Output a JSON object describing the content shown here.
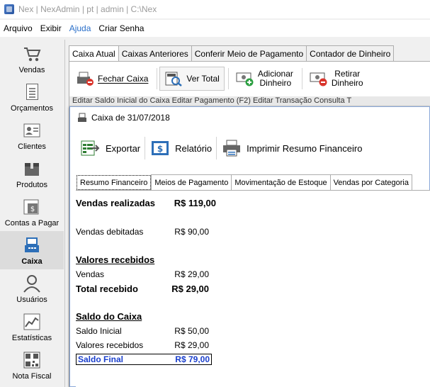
{
  "window": {
    "title": "Nex | NexAdmin | pt | admin | C:\\Nex"
  },
  "menu": [
    "Arquivo",
    "Exibir",
    "Ajuda",
    "Criar Senha"
  ],
  "sidebar": [
    {
      "label": "Vendas",
      "icon": "cart-icon"
    },
    {
      "label": "Orçamentos",
      "icon": "document-icon"
    },
    {
      "label": "Clientes",
      "icon": "contact-card-icon"
    },
    {
      "label": "Produtos",
      "icon": "box-icon"
    },
    {
      "label": "Contas a Pagar",
      "icon": "bill-icon"
    },
    {
      "label": "Caixa",
      "icon": "cash-register-icon"
    },
    {
      "label": "Usuários",
      "icon": "user-icon"
    },
    {
      "label": "Estatísticas",
      "icon": "chart-icon"
    },
    {
      "label": "Nota Fiscal",
      "icon": "qr-code-icon"
    }
  ],
  "main_tabs": [
    "Caixa Atual",
    "Caixas Anteriores",
    "Conferir Meio de Pagamento",
    "Contador de Dinheiro"
  ],
  "main_toolbar": {
    "fechar": "Fechar Caixa",
    "ver_total": "Ver Total",
    "adicionar_1": "Adicionar",
    "adicionar_2": "Dinheiro",
    "retirar_1": "Retirar",
    "retirar_2": "Dinheiro"
  },
  "subbar_text": "Editar Saldo Inicial do Caixa    Editar Pagamento (F2)    Editar Transação    Consulta T",
  "dialog": {
    "title": "Caixa de 31/07/2018",
    "toolbar": {
      "exportar": "Exportar",
      "relatorio": "Relatório",
      "imprimir": "Imprimir Resumo Financeiro"
    },
    "tabs": [
      "Resumo Financeiro",
      "Meios de Pagamento",
      "Movimentação de Estoque",
      "Vendas por Categoria"
    ],
    "report": {
      "vendas_realizadas_label": "Vendas realizadas",
      "vendas_realizadas_value": "R$ 119,00",
      "vendas_debitadas_label": "Vendas debitadas",
      "vendas_debitadas_value": "R$ 90,00",
      "valores_recebidos_heading": "Valores recebidos",
      "vendas_label": "Vendas",
      "vendas_value": "R$ 29,00",
      "total_recebido_label": "Total recebido",
      "total_recebido_value": "R$ 29,00",
      "saldo_heading": "Saldo do Caixa",
      "saldo_inicial_label": "Saldo Inicial",
      "saldo_inicial_value": "R$ 50,00",
      "valores_recebidos_label": "Valores recebidos",
      "valores_recebidos_value": "R$ 29,00",
      "saldo_final_label": "Saldo Final",
      "saldo_final_value": "R$ 79,00"
    }
  }
}
